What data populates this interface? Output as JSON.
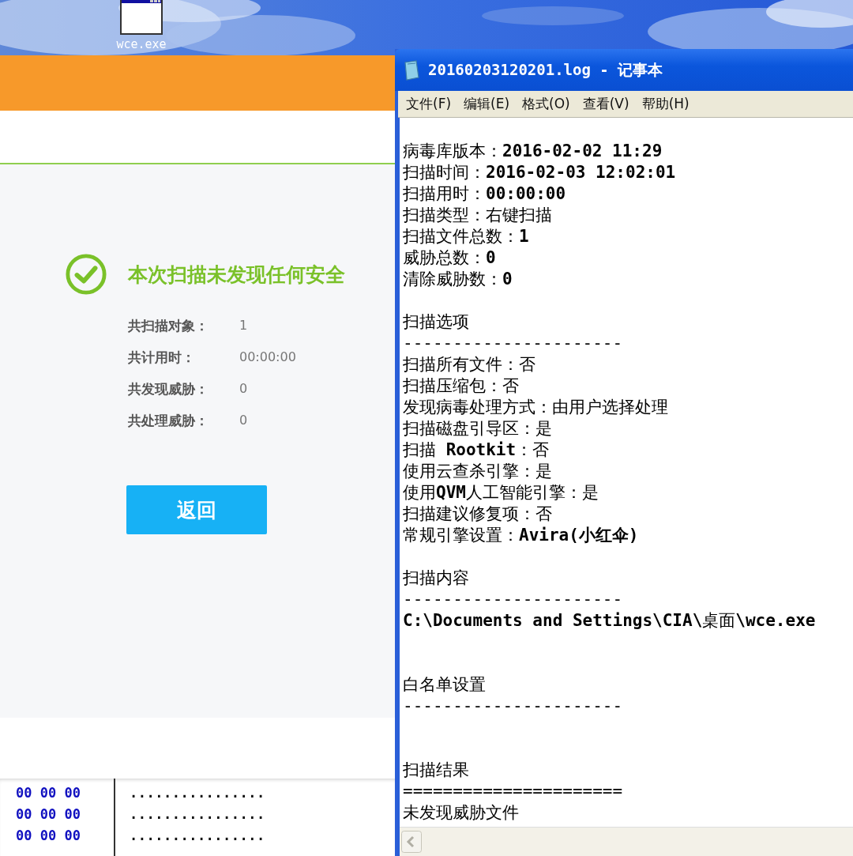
{
  "desktop": {
    "icons": [
      {
        "label": "wce.exe"
      }
    ]
  },
  "scanner": {
    "heading": "本次扫描未发现任何安全",
    "stats": [
      {
        "label": "共扫描对象：",
        "value": "1"
      },
      {
        "label": "共计用时：",
        "value": "00:00:00"
      },
      {
        "label": "共发现威胁：",
        "value": "0"
      },
      {
        "label": "共处理威胁：",
        "value": "0"
      }
    ],
    "return_button": "返回"
  },
  "hex_view": {
    "rows": [
      {
        "bytes": "00 00 00",
        "text": "................"
      },
      {
        "bytes": "00 00 00",
        "text": "................"
      },
      {
        "bytes": "00 00 00",
        "text": "................"
      }
    ]
  },
  "notepad": {
    "title": "20160203120201.log - 记事本",
    "menu": [
      "文件(F)",
      "编辑(E)",
      "格式(O)",
      "查看(V)",
      "帮助(H)"
    ],
    "blocks": [
      {
        "lines": [
          "病毒库版本：**2016-02-02 11:29**",
          "扫描时间：**2016-02-03 12:02:01**",
          "扫描用时：**00:00:00**",
          "扫描类型：右键扫描",
          "扫描文件总数：**1**",
          "威胁总数：**0**",
          "清除威胁数：**0**"
        ]
      },
      {
        "lines": [
          "扫描选项",
          "----------------------",
          "扫描所有文件：否",
          "扫描压缩包：否",
          "发现病毒处理方式：由用户选择处理",
          "扫描磁盘引导区：是",
          "扫描 **Rootkit**：否",
          "使用云查杀引擎：是",
          "使用**QVM**人工智能引擎：是",
          "扫描建议修复项：否",
          "常规引擎设置：**Avira(小红伞)**"
        ]
      },
      {
        "lines": [
          "扫描内容",
          "----------------------",
          "**C:\\Documents and Settings\\CIA\\**桌面**\\wce.exe**"
        ]
      },
      {
        "lines": [
          "白名单设置",
          "----------------------"
        ]
      },
      {
        "lines": [
          "扫描结果",
          "======================",
          "未发现威胁文件"
        ]
      }
    ]
  }
}
